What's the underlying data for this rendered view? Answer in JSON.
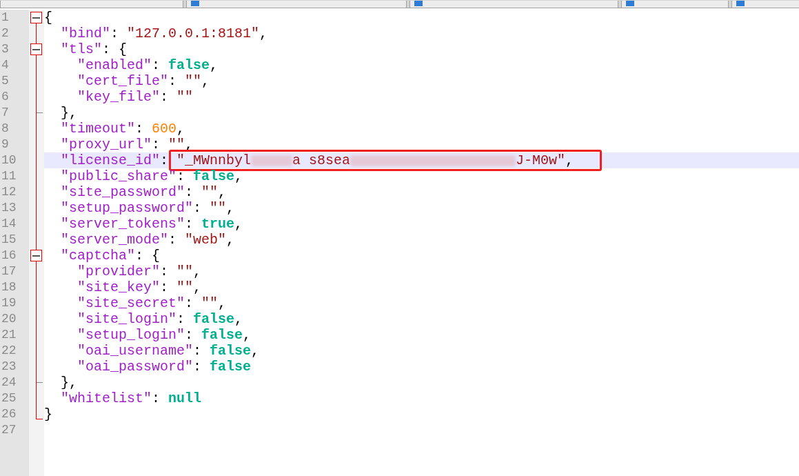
{
  "editor": {
    "lines": [
      {
        "number": "1",
        "kind": "fold_start",
        "current": false,
        "boxed": false,
        "tokens": [
          {
            "kind": "punct",
            "text": "{"
          }
        ]
      },
      {
        "number": "2",
        "kind": "plain",
        "current": false,
        "boxed": false,
        "tokens": [
          {
            "kind": "key",
            "text": "  \"bind\""
          },
          {
            "kind": "punct",
            "text": ": "
          },
          {
            "kind": "string",
            "text": "\"127.0.0.1:8181\""
          },
          {
            "kind": "punct",
            "text": ","
          }
        ]
      },
      {
        "number": "3",
        "kind": "fold_start",
        "current": false,
        "boxed": false,
        "tokens": [
          {
            "kind": "key",
            "text": "  \"tls\""
          },
          {
            "kind": "punct",
            "text": ": {"
          }
        ]
      },
      {
        "number": "4",
        "kind": "plain",
        "current": false,
        "boxed": false,
        "tokens": [
          {
            "kind": "key",
            "text": "    \"enabled\""
          },
          {
            "kind": "punct",
            "text": ": "
          },
          {
            "kind": "literal",
            "text": "false"
          },
          {
            "kind": "punct",
            "text": ","
          }
        ]
      },
      {
        "number": "5",
        "kind": "plain",
        "current": false,
        "boxed": false,
        "tokens": [
          {
            "kind": "key",
            "text": "    \"cert_file\""
          },
          {
            "kind": "punct",
            "text": ": "
          },
          {
            "kind": "string",
            "text": "\"\""
          },
          {
            "kind": "punct",
            "text": ","
          }
        ]
      },
      {
        "number": "6",
        "kind": "plain",
        "current": false,
        "boxed": false,
        "tokens": [
          {
            "kind": "key",
            "text": "    \"key_file\""
          },
          {
            "kind": "punct",
            "text": ": "
          },
          {
            "kind": "string",
            "text": "\"\""
          }
        ]
      },
      {
        "number": "7",
        "kind": "fold_end",
        "current": false,
        "boxed": false,
        "tokens": [
          {
            "kind": "punct",
            "text": "  },"
          }
        ]
      },
      {
        "number": "8",
        "kind": "plain",
        "current": false,
        "boxed": false,
        "tokens": [
          {
            "kind": "key",
            "text": "  \"timeout\""
          },
          {
            "kind": "punct",
            "text": ": "
          },
          {
            "kind": "number",
            "text": "600"
          },
          {
            "kind": "punct",
            "text": ","
          }
        ]
      },
      {
        "number": "9",
        "kind": "plain",
        "current": false,
        "boxed": false,
        "tokens": [
          {
            "kind": "key",
            "text": "  \"proxy_url\""
          },
          {
            "kind": "punct",
            "text": ": "
          },
          {
            "kind": "string",
            "text": "\"\""
          },
          {
            "kind": "punct",
            "text": ","
          }
        ]
      },
      {
        "number": "10",
        "kind": "plain",
        "current": true,
        "boxed": true,
        "tokens": [
          {
            "kind": "key",
            "text": "  \"license_id\""
          },
          {
            "kind": "punct",
            "text": ": "
          },
          {
            "kind": "string",
            "text": "\"_MWnnbyl"
          },
          {
            "kind": "blur_short"
          },
          {
            "kind": "string",
            "text": "a s8sea"
          },
          {
            "kind": "blur_long"
          },
          {
            "kind": "string",
            "text": "J-M0w\""
          },
          {
            "kind": "punct",
            "text": ","
          }
        ]
      },
      {
        "number": "11",
        "kind": "plain",
        "current": false,
        "boxed": false,
        "tokens": [
          {
            "kind": "key",
            "text": "  \"public_share\""
          },
          {
            "kind": "punct",
            "text": ": "
          },
          {
            "kind": "literal",
            "text": "false"
          },
          {
            "kind": "punct",
            "text": ","
          }
        ]
      },
      {
        "number": "12",
        "kind": "plain",
        "current": false,
        "boxed": false,
        "tokens": [
          {
            "kind": "key",
            "text": "  \"site_password\""
          },
          {
            "kind": "punct",
            "text": ": "
          },
          {
            "kind": "string",
            "text": "\"\""
          },
          {
            "kind": "punct",
            "text": ","
          }
        ]
      },
      {
        "number": "13",
        "kind": "plain",
        "current": false,
        "boxed": false,
        "tokens": [
          {
            "kind": "key",
            "text": "  \"setup_password\""
          },
          {
            "kind": "punct",
            "text": ": "
          },
          {
            "kind": "string",
            "text": "\"\""
          },
          {
            "kind": "punct",
            "text": ","
          }
        ]
      },
      {
        "number": "14",
        "kind": "plain",
        "current": false,
        "boxed": false,
        "tokens": [
          {
            "kind": "key",
            "text": "  \"server_tokens\""
          },
          {
            "kind": "punct",
            "text": ": "
          },
          {
            "kind": "literal",
            "text": "true"
          },
          {
            "kind": "punct",
            "text": ","
          }
        ]
      },
      {
        "number": "15",
        "kind": "plain",
        "current": false,
        "boxed": false,
        "tokens": [
          {
            "kind": "key",
            "text": "  \"server_mode\""
          },
          {
            "kind": "punct",
            "text": ": "
          },
          {
            "kind": "string",
            "text": "\"web\""
          },
          {
            "kind": "punct",
            "text": ","
          }
        ]
      },
      {
        "number": "16",
        "kind": "fold_start",
        "current": false,
        "boxed": false,
        "tokens": [
          {
            "kind": "key",
            "text": "  \"captcha\""
          },
          {
            "kind": "punct",
            "text": ": {"
          }
        ]
      },
      {
        "number": "17",
        "kind": "plain",
        "current": false,
        "boxed": false,
        "tokens": [
          {
            "kind": "key",
            "text": "    \"provider\""
          },
          {
            "kind": "punct",
            "text": ": "
          },
          {
            "kind": "string",
            "text": "\"\""
          },
          {
            "kind": "punct",
            "text": ","
          }
        ]
      },
      {
        "number": "18",
        "kind": "plain",
        "current": false,
        "boxed": false,
        "tokens": [
          {
            "kind": "key",
            "text": "    \"site_key\""
          },
          {
            "kind": "punct",
            "text": ": "
          },
          {
            "kind": "string",
            "text": "\"\""
          },
          {
            "kind": "punct",
            "text": ","
          }
        ]
      },
      {
        "number": "19",
        "kind": "plain",
        "current": false,
        "boxed": false,
        "tokens": [
          {
            "kind": "key",
            "text": "    \"site_secret\""
          },
          {
            "kind": "punct",
            "text": ": "
          },
          {
            "kind": "string",
            "text": "\"\""
          },
          {
            "kind": "punct",
            "text": ","
          }
        ]
      },
      {
        "number": "20",
        "kind": "plain",
        "current": false,
        "boxed": false,
        "tokens": [
          {
            "kind": "key",
            "text": "    \"site_login\""
          },
          {
            "kind": "punct",
            "text": ": "
          },
          {
            "kind": "literal",
            "text": "false"
          },
          {
            "kind": "punct",
            "text": ","
          }
        ]
      },
      {
        "number": "21",
        "kind": "plain",
        "current": false,
        "boxed": false,
        "tokens": [
          {
            "kind": "key",
            "text": "    \"setup_login\""
          },
          {
            "kind": "punct",
            "text": ": "
          },
          {
            "kind": "literal",
            "text": "false"
          },
          {
            "kind": "punct",
            "text": ","
          }
        ]
      },
      {
        "number": "22",
        "kind": "plain",
        "current": false,
        "boxed": false,
        "tokens": [
          {
            "kind": "key",
            "text": "    \"oai_username\""
          },
          {
            "kind": "punct",
            "text": ": "
          },
          {
            "kind": "literal",
            "text": "false"
          },
          {
            "kind": "punct",
            "text": ","
          }
        ]
      },
      {
        "number": "23",
        "kind": "plain",
        "current": false,
        "boxed": false,
        "tokens": [
          {
            "kind": "key",
            "text": "    \"oai_password\""
          },
          {
            "kind": "punct",
            "text": ": "
          },
          {
            "kind": "literal",
            "text": "false"
          }
        ]
      },
      {
        "number": "24",
        "kind": "fold_end",
        "current": false,
        "boxed": false,
        "tokens": [
          {
            "kind": "punct",
            "text": "  },"
          }
        ]
      },
      {
        "number": "25",
        "kind": "plain",
        "current": false,
        "boxed": false,
        "tokens": [
          {
            "kind": "key",
            "text": "  \"whitelist\""
          },
          {
            "kind": "punct",
            "text": ": "
          },
          {
            "kind": "literal",
            "text": "null"
          }
        ]
      },
      {
        "number": "26",
        "kind": "fold_last",
        "current": false,
        "boxed": false,
        "tokens": [
          {
            "kind": "punct",
            "text": "}"
          }
        ]
      },
      {
        "number": "27",
        "kind": "plain",
        "current": false,
        "boxed": false
      }
    ]
  }
}
